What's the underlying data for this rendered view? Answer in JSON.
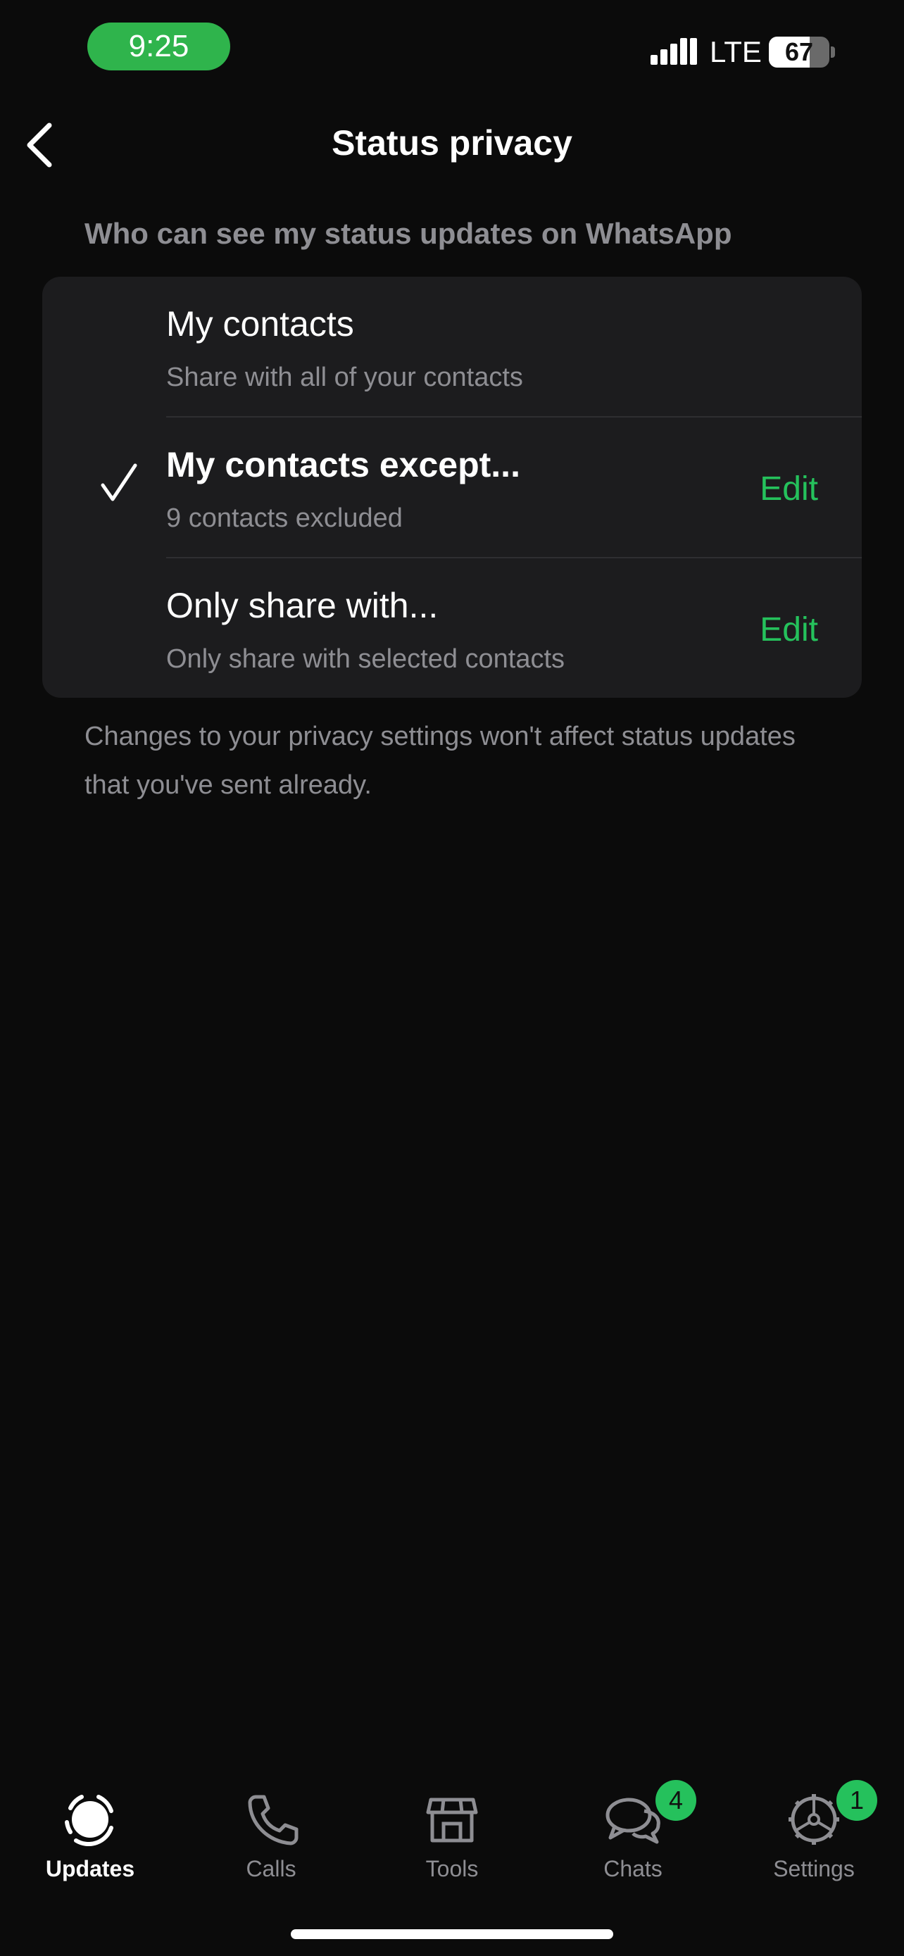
{
  "status_bar": {
    "time": "9:25",
    "network": "LTE",
    "battery": "67",
    "battery_level_percent": 67
  },
  "nav": {
    "title": "Status privacy",
    "back_icon": "chevron-left-icon"
  },
  "section_header": "Who can see my status updates on WhatsApp",
  "options": [
    {
      "title": "My contacts",
      "subtitle": "Share with all of your contacts",
      "selected": false
    },
    {
      "title": "My contacts except...",
      "subtitle": "9 contacts excluded",
      "selected": true,
      "edit_label": "Edit"
    },
    {
      "title": "Only share with...",
      "subtitle": "Only share with selected contacts",
      "selected": false,
      "edit_label": "Edit"
    }
  ],
  "footer_note": "Changes to your privacy settings won't affect status updates that you've sent already.",
  "tabs": [
    {
      "label": "Updates",
      "icon": "updates-icon",
      "active": true
    },
    {
      "label": "Calls",
      "icon": "phone-icon"
    },
    {
      "label": "Tools",
      "icon": "storefront-icon"
    },
    {
      "label": "Chats",
      "icon": "chat-bubbles-icon",
      "badge": "4"
    },
    {
      "label": "Settings",
      "icon": "gear-icon",
      "badge": "1"
    }
  ],
  "colors": {
    "accent": "#25c15c",
    "background": "#0b0b0b",
    "card": "#1c1c1e",
    "secondary_text": "#8e8e93",
    "time_pill": "#2fb44c"
  }
}
